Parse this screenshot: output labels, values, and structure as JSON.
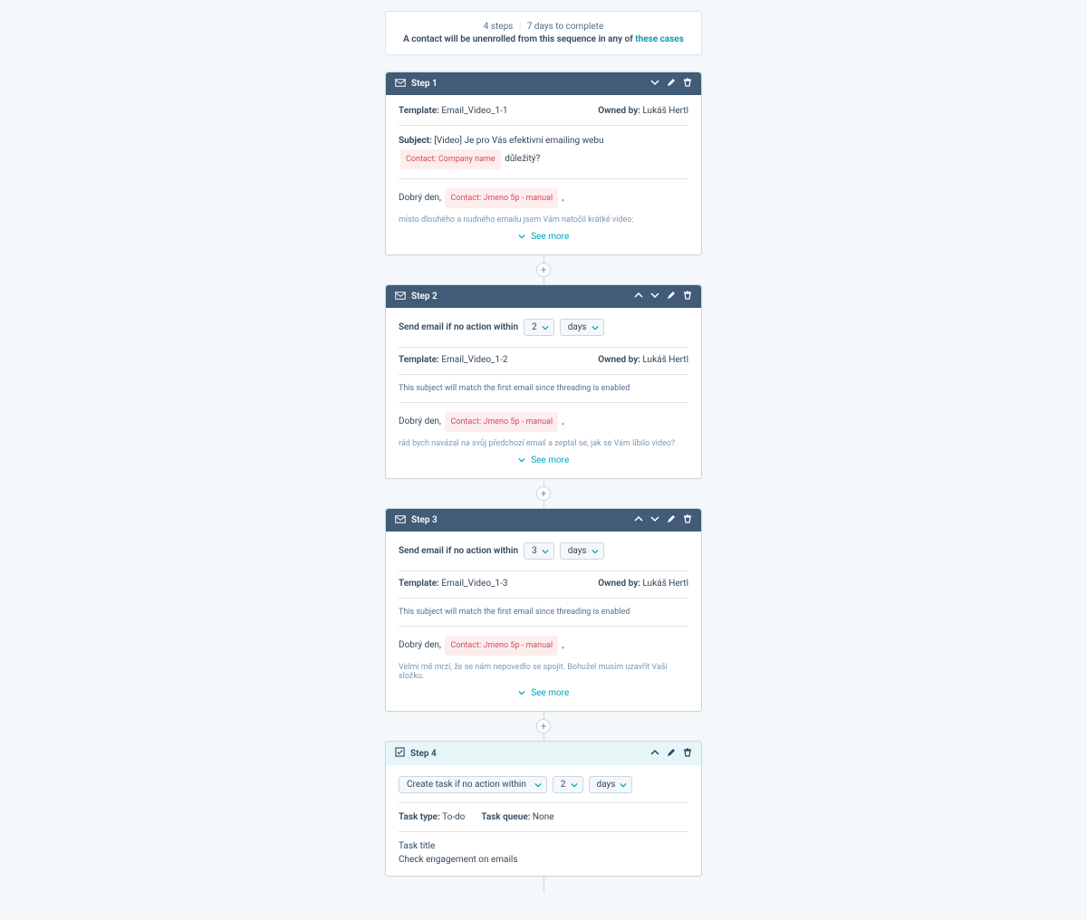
{
  "summary": {
    "steps_text": "4 steps",
    "days_text": "7 days to complete",
    "unenroll_text": "A contact will be unenrolled from this sequence in any of ",
    "link_text": "these cases"
  },
  "labels": {
    "template": "Template:",
    "subject": "Subject:",
    "owned_by": "Owned by:",
    "see_more": "See more",
    "send_no_action": "Send email if no action within",
    "create_no_action": "Create task if no action within",
    "task_type": "Task type:",
    "task_queue": "Task queue:",
    "task_title": "Task title",
    "threading_hint": "This subject will match the first email since threading is enabled"
  },
  "tokens": {
    "company": "Contact: Company name",
    "jmeno": "Contact: Jmeno 5p - manual"
  },
  "steps": [
    {
      "title": "Step 1",
      "type": "email",
      "template": "Email_Video_1-1",
      "owner": "Lukáš Hertl",
      "subject_pre": "[Video] Je pro Vás efektivní emailing webu ",
      "subject_post": " důležitý?",
      "greeting": "Dobrý den, ",
      "greeting_post": " ,",
      "body_line": "místo dlouhého a nudného emailu jsem Vám natočil krátké video:"
    },
    {
      "title": "Step 2",
      "type": "email",
      "delay_value": "2",
      "delay_unit": "days",
      "template": "Email_Video_1-2",
      "owner": "Lukáš Hertl",
      "greeting": "Dobrý den, ",
      "greeting_post": " ,",
      "body_line": "rád bych navázal na svůj předchozí email a zeptal se, jak se Vám líbilo video?"
    },
    {
      "title": "Step 3",
      "type": "email",
      "delay_value": "3",
      "delay_unit": "days",
      "template": "Email_Video_1-3",
      "owner": "Lukáš Hertl",
      "greeting": "Dobrý den, ",
      "greeting_post": " ,",
      "body_line": "Velmi mě mrzí, že se nám nepovedlo se spojit. Bohužel musím uzavřít Vaši složku."
    },
    {
      "title": "Step 4",
      "type": "task",
      "delay_value": "2",
      "delay_unit": "days",
      "task_type": "To-do",
      "task_queue": "None",
      "task_title_value": "Check engagement on emails"
    }
  ]
}
